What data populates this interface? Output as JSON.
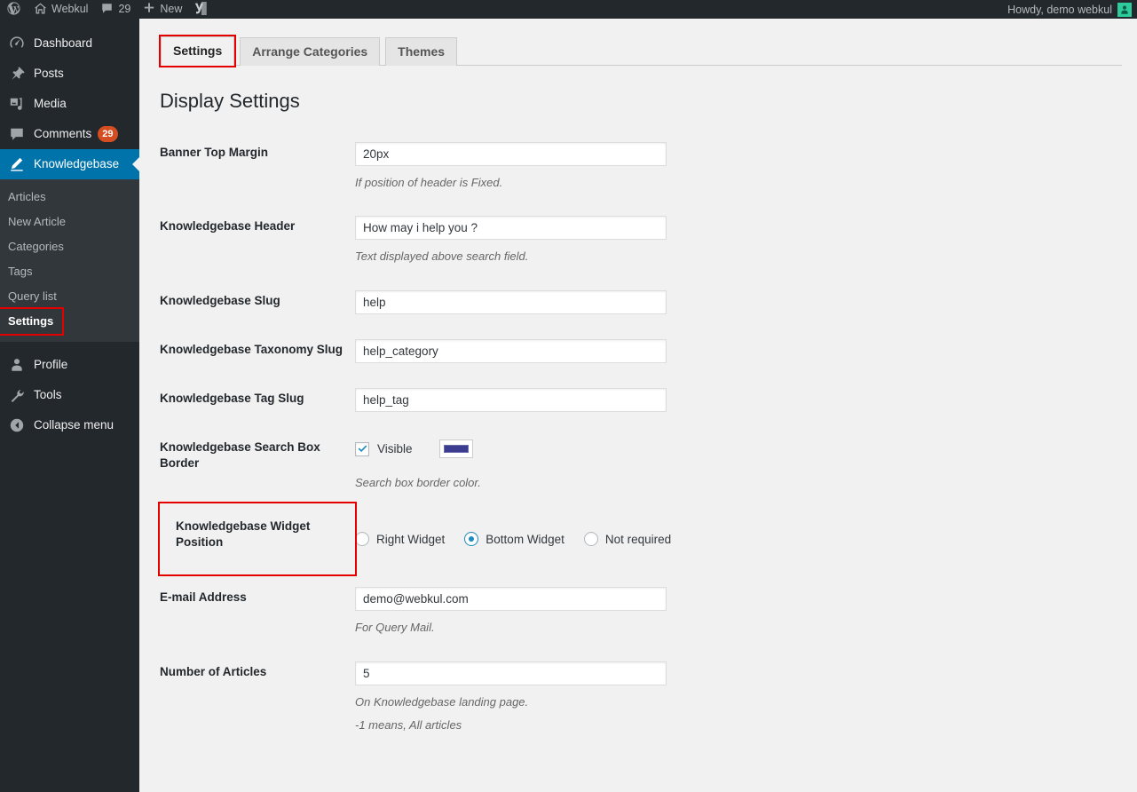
{
  "adminbar": {
    "wp_logo": "wordpress-logo",
    "site_name": "Webkul",
    "comments_count": "29",
    "new_label": "New",
    "yoast_label": "Y",
    "howdy": "Howdy, demo webkul"
  },
  "sidebar": {
    "top_items": [
      {
        "label": "Dashboard",
        "icon": "dashboard-icon",
        "current": false
      },
      {
        "label": "Posts",
        "icon": "pin-icon",
        "current": false
      },
      {
        "label": "Media",
        "icon": "media-icon",
        "current": false
      },
      {
        "label": "Comments",
        "icon": "comment-icon",
        "current": false,
        "badge": "29"
      },
      {
        "label": "Knowledgebase",
        "icon": "pencil-icon",
        "current": true
      }
    ],
    "sub_items": [
      {
        "label": "Articles",
        "current": false
      },
      {
        "label": "New Article",
        "current": false
      },
      {
        "label": "Categories",
        "current": false
      },
      {
        "label": "Tags",
        "current": false
      },
      {
        "label": "Query list",
        "current": false
      },
      {
        "label": "Settings",
        "current": true,
        "highlighted": true
      }
    ],
    "bottom_items": [
      {
        "label": "Profile",
        "icon": "user-icon"
      },
      {
        "label": "Tools",
        "icon": "wrench-icon"
      },
      {
        "label": "Collapse menu",
        "icon": "collapse-icon"
      }
    ],
    "highlight_color": "#e50000",
    "active_color": "#0073aa"
  },
  "tabs": [
    {
      "label": "Settings",
      "active": true,
      "highlighted": true
    },
    {
      "label": "Arrange Categories",
      "active": false,
      "highlighted": false
    },
    {
      "label": "Themes",
      "active": false,
      "highlighted": false
    }
  ],
  "page": {
    "title": "Display Settings"
  },
  "fields": {
    "banner_top_margin": {
      "label": "Banner Top Margin",
      "value": "20px",
      "description": "If position of header is Fixed."
    },
    "kb_header": {
      "label": "Knowledgebase Header",
      "value": "How may i help you ?",
      "description": "Text displayed above search field."
    },
    "kb_slug": {
      "label": "Knowledgebase Slug",
      "value": "help"
    },
    "kb_taxonomy_slug": {
      "label": "Knowledgebase Taxonomy Slug",
      "value": "help_category"
    },
    "kb_tag_slug": {
      "label": "Knowledgebase Tag Slug",
      "value": "help_tag"
    },
    "search_box_border": {
      "label": "Knowledgebase Search Box Border",
      "checkbox_label": "Visible",
      "checked": true,
      "color": "#3b3b8f",
      "description": "Search box border color."
    },
    "widget_position": {
      "label": "Knowledgebase Widget Position",
      "highlighted": true,
      "options": [
        {
          "label": "Right Widget",
          "selected": false
        },
        {
          "label": "Bottom Widget",
          "selected": true
        },
        {
          "label": "Not required",
          "selected": false
        }
      ]
    },
    "email_address": {
      "label": "E-mail Address",
      "value": "demo@webkul.com",
      "description": "For Query Mail."
    },
    "number_of_articles": {
      "label": "Number of Articles",
      "value": "5",
      "description": "On Knowledgebase landing page.",
      "description2": "-1 means, All articles"
    }
  }
}
